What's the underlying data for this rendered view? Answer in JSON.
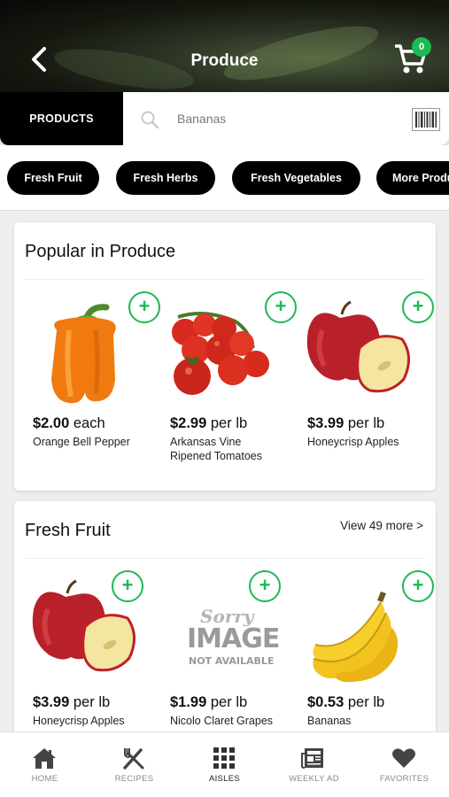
{
  "header": {
    "title": "Produce",
    "cart_count": "0"
  },
  "search": {
    "tab_label": "PRODUCTS",
    "placeholder": "Bananas"
  },
  "categories": [
    "Fresh Fruit",
    "Fresh Herbs",
    "Fresh Vegetables",
    "More Produce"
  ],
  "sections": [
    {
      "title": "Popular in Produce",
      "link": "",
      "products": [
        {
          "price_amount": "$2.00",
          "price_unit": " each",
          "name": "Orange Bell Pepper",
          "image": "orange-bell-pepper"
        },
        {
          "price_amount": "$2.99",
          "price_unit": " per lb",
          "name": "Arkansas Vine Ripened Tomatoes",
          "image": "vine-tomatoes"
        },
        {
          "price_amount": "$3.99",
          "price_unit": " per lb",
          "name": "Honeycrisp Apples",
          "image": "honeycrisp-apple"
        }
      ]
    },
    {
      "title": "Fresh Fruit",
      "link": "View 49 more >",
      "products": [
        {
          "price_amount": "$3.99",
          "price_unit": " per lb",
          "name": "Honeycrisp Apples",
          "image": "honeycrisp-apple"
        },
        {
          "price_amount": "$1.99",
          "price_unit": " per lb",
          "name": "Nicolo Claret Grapes",
          "image": "image-not-available"
        },
        {
          "price_amount": "$0.53",
          "price_unit": " per lb",
          "name": "Bananas",
          "image": "bananas"
        }
      ]
    }
  ],
  "placeholder_image": {
    "line1": "Sorry",
    "line2": "IMAGE",
    "line3": "NOT AVAILABLE"
  },
  "tabs": [
    {
      "label": "HOME",
      "icon": "home-icon"
    },
    {
      "label": "RECIPES",
      "icon": "utensils-icon"
    },
    {
      "label": "AISLES",
      "icon": "grid-icon",
      "active": true
    },
    {
      "label": "WEEKLY AD",
      "icon": "newspaper-icon"
    },
    {
      "label": "FAVORITES",
      "icon": "heart-icon"
    }
  ],
  "colors": {
    "accent": "#1db954",
    "chip": "#000000"
  }
}
